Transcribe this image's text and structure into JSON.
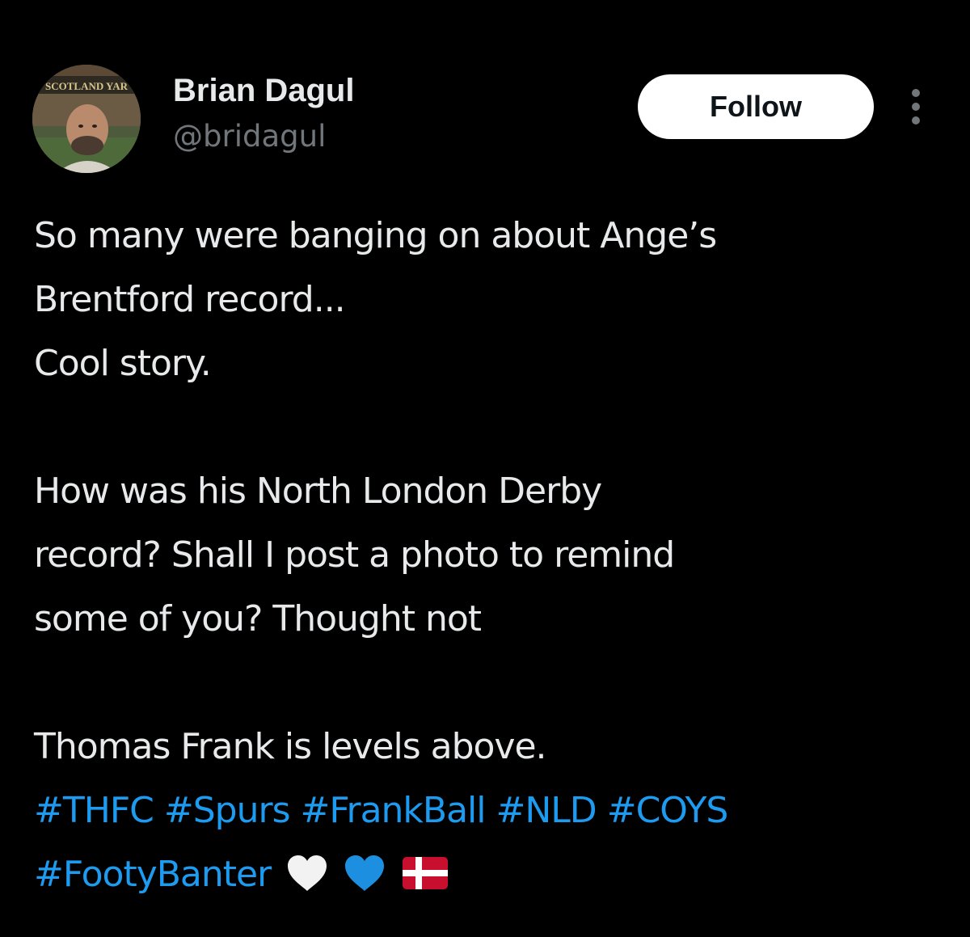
{
  "author": {
    "display_name": "Brian Dagul",
    "handle": "@bridagul",
    "avatar_sign_text": "SCOTLAND YAR"
  },
  "actions": {
    "follow_label": "Follow",
    "more_icon": "more-vertical-icon"
  },
  "tweet": {
    "lines": [
      "So many were banging on about Ange’s",
      "Brentford record...",
      "Cool story.",
      "",
      "How was his North London Derby",
      "record? Shall I post a photo to remind",
      "some of you? Thought not",
      "",
      "Thomas Frank is levels above."
    ],
    "hashtags_line1": [
      "#THFC",
      "#Spurs",
      "#FrankBall",
      "#NLD",
      "#COYS"
    ],
    "hashtags_line2": [
      "#FootyBanter"
    ],
    "emojis": [
      "white-heart-emoji",
      "blue-heart-emoji",
      "denmark-flag-emoji"
    ]
  },
  "colors": {
    "background": "#000000",
    "text_primary": "#e7e9ea",
    "text_secondary": "#71767b",
    "hashtag": "#1d9bf0",
    "follow_bg": "#ffffff",
    "denmark_red": "#c8102e"
  }
}
